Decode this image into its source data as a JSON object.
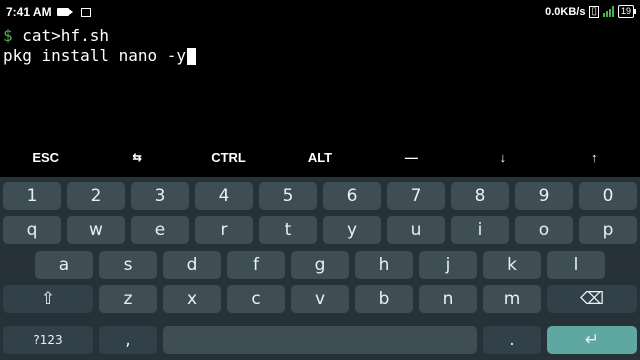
{
  "status_bar": {
    "time": "7:41 AM",
    "net_speed": "0.0KB/s",
    "battery": "19",
    "icons": [
      "camera-icon",
      "screen-icon",
      "volte-icon",
      "signal-icon",
      "battery-icon"
    ]
  },
  "terminal": {
    "prompt": "$",
    "line1_cmd": " cat>hf.sh",
    "line2_text": "pkg install nano -y"
  },
  "extra_keys": [
    "ESC",
    "⇆",
    "CTRL",
    "ALT",
    "—",
    "↓",
    "↑"
  ],
  "keyboard": {
    "row1": [
      "1",
      "2",
      "3",
      "4",
      "5",
      "6",
      "7",
      "8",
      "9",
      "0"
    ],
    "row2": [
      "q",
      "w",
      "e",
      "r",
      "t",
      "y",
      "u",
      "i",
      "o",
      "p"
    ],
    "row3": [
      "a",
      "s",
      "d",
      "f",
      "g",
      "h",
      "j",
      "k",
      "l"
    ],
    "row4": [
      "z",
      "x",
      "c",
      "v",
      "b",
      "n",
      "m"
    ],
    "shift": "⇧",
    "backspace": "⌫",
    "symbols": "?123",
    "comma": ",",
    "period": ".",
    "enter": "↵"
  },
  "colors": {
    "keyboard_bg": "#263238",
    "key_bg": "#3f4d55",
    "enter_bg": "#5fa7a1",
    "prompt": "#4caf50"
  }
}
